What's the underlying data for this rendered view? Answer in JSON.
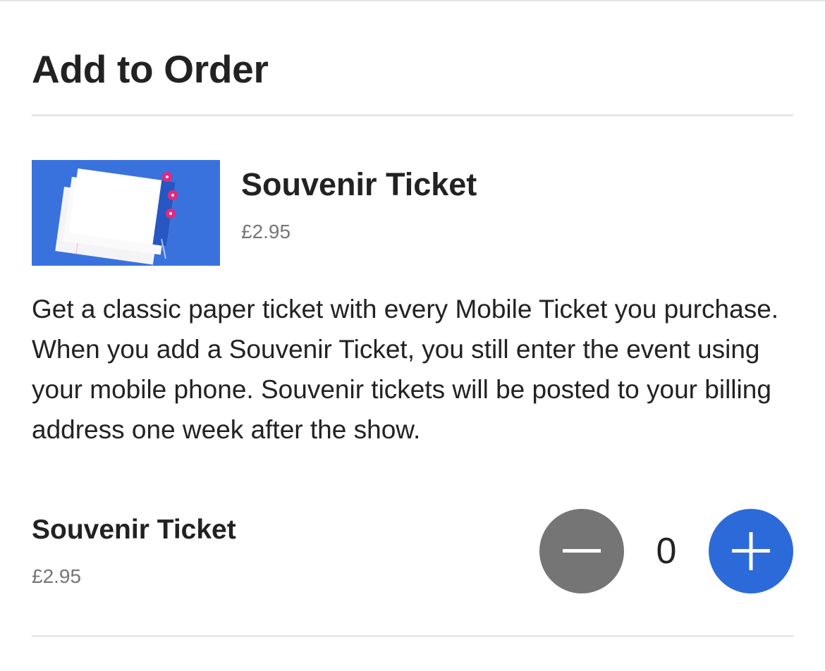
{
  "page": {
    "title": "Add to Order"
  },
  "product": {
    "name": "Souvenir Ticket",
    "price": "£2.95",
    "image_icon": "souvenir-ticket-image",
    "description": "Get a classic paper ticket with every Mobile Ticket you purchase. When you add a Souvenir Ticket, you still enter the event using your mobile phone. Souvenir tickets will be posted to your billing address one week after the show."
  },
  "quantity_selector": {
    "item_name": "Souvenir Ticket",
    "item_price": "£2.95",
    "quantity": "0",
    "decrement_icon": "minus-icon",
    "increment_icon": "plus-icon"
  },
  "colors": {
    "image_background": "#3a72dd",
    "decrement_button": "#757575",
    "increment_button": "#2d6ad9",
    "ticket_badge": "#e8267c",
    "text_primary": "#222222",
    "text_secondary": "#767676"
  }
}
